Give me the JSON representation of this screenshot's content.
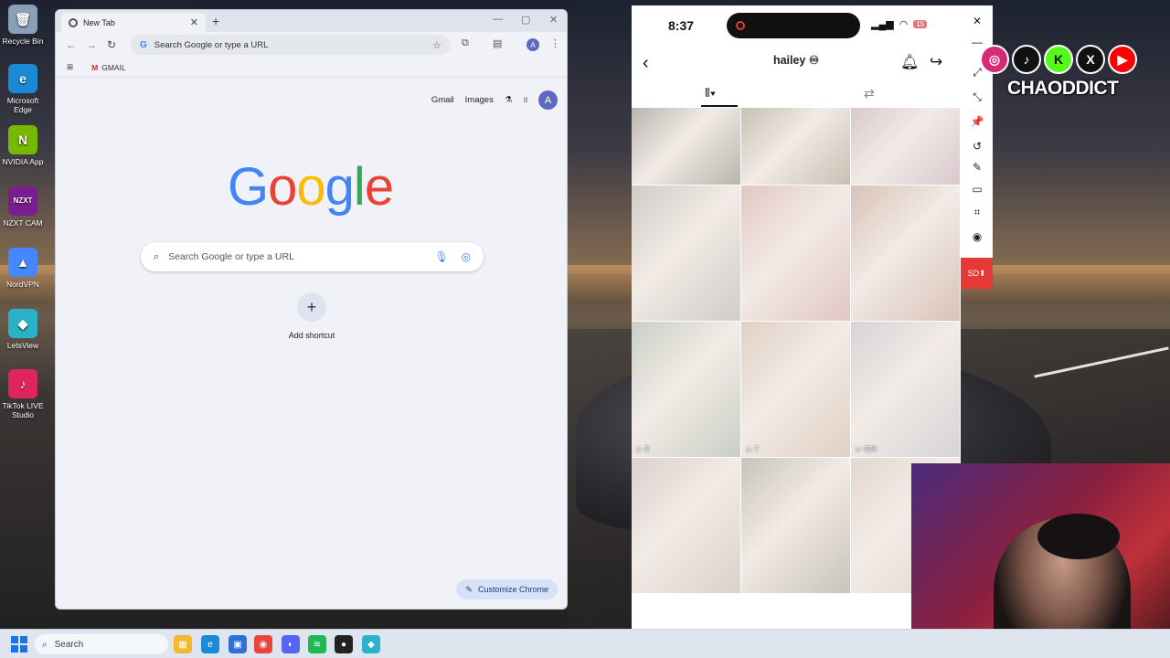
{
  "desktop": {
    "icons": [
      {
        "label": "Recycle Bin",
        "glyph": "🗑",
        "color": "#8aa0b8"
      },
      {
        "label": "Microsoft Edge",
        "glyph": "e",
        "color": "#1b8ad6"
      },
      {
        "label": "NVIDIA App",
        "glyph": "N",
        "color": "#76b900"
      },
      {
        "label": "NZXT CAM",
        "glyph": "NZXT",
        "color": "#7a1f8f"
      },
      {
        "label": "NordVPN",
        "glyph": "▲",
        "color": "#4687ff"
      },
      {
        "label": "LetsView",
        "glyph": "◆",
        "color": "#2ab3c8"
      },
      {
        "label": "TikTok LIVE Studio",
        "glyph": "♪",
        "color": "#e0245e"
      }
    ]
  },
  "chrome": {
    "tab_title": "New Tab",
    "tab_close": "✕",
    "new_tab": "+",
    "win_min": "—",
    "win_max": "▢",
    "win_close": "✕",
    "nav_back": "←",
    "nav_forward": "→",
    "nav_reload": "↻",
    "omnibox_placeholder": "Search Google or type a URL",
    "omnibox_g": "G",
    "omnibox_star": "☆",
    "bookmark_gmail": "GMAIL",
    "bookmark_gmail_icon": "M",
    "apps_grid": "⊞",
    "avatar_letter": "A",
    "ntp_gmail": "Gmail",
    "ntp_images": "Images",
    "ntp_flask": "⚗",
    "ntp_apps": "⋮⋮⋮",
    "logo": [
      "G",
      "o",
      "o",
      "g",
      "l",
      "e"
    ],
    "logo_colors": [
      "#4285f4",
      "#ea4335",
      "#fbbc05",
      "#4285f4",
      "#34a853",
      "#ea4335"
    ],
    "search_placeholder": "Search Google or type a URL",
    "search_icon": "🔍",
    "mic_icon": "🎤",
    "lens_icon": "◎",
    "shortcut_plus": "+",
    "shortcut_label": "Add shortcut",
    "customize_label": "Customize Chrome",
    "customize_icon": "✎"
  },
  "phone": {
    "time": "8:37",
    "signal": "▂▄▆",
    "wifi": "◠",
    "battery": "15",
    "back": "‹",
    "profile_name": "hailey ♾",
    "bell": "🔔",
    "share": "↪",
    "grid_tab": "⦀▾",
    "repost_tab": "⇄",
    "thumbnails": [
      {
        "views": "",
        "color": "#b8b4ac",
        "short": true
      },
      {
        "views": "",
        "color": "#c7c0b3",
        "short": true
      },
      {
        "views": "",
        "color": "#d9c8cd",
        "short": true
      },
      {
        "views": "",
        "color": "#d0ccc8"
      },
      {
        "views": "",
        "color": "#e2c6c2"
      },
      {
        "views": "",
        "color": "#d8c2b8"
      },
      {
        "views": "9",
        "color": "#c9cfc6"
      },
      {
        "views": "7",
        "color": "#e0d0c4"
      },
      {
        "views": "928",
        "color": "#d6d4d6"
      },
      {
        "views": "",
        "color": "#dcd0cc"
      },
      {
        "views": "",
        "color": "#c8c4ba"
      },
      {
        "views": "",
        "color": "#e4d8cf"
      }
    ]
  },
  "side_toolbar": {
    "tools": [
      "✕",
      "—",
      "⤢",
      "⤡",
      "📌",
      "↺",
      "✎",
      "▭",
      "⌗",
      "◉"
    ],
    "sd_label": "SD⬆"
  },
  "overlay": {
    "socials": [
      {
        "glyph": "◎",
        "color": "#d62976"
      },
      {
        "glyph": "♪",
        "color": "#111111"
      },
      {
        "glyph": "K",
        "color": "#53fc18"
      },
      {
        "glyph": "X",
        "color": "#111111"
      },
      {
        "glyph": "▶",
        "color": "#ff0000"
      }
    ],
    "brand": "CHAODDICT"
  },
  "taskbar": {
    "search_label": "Search",
    "search_icon": "🔍",
    "apps": [
      {
        "glyph": "▦",
        "color": "#f3b92c"
      },
      {
        "glyph": "e",
        "color": "#1b8ad6"
      },
      {
        "glyph": "▣",
        "color": "#2f6fd6"
      },
      {
        "glyph": "◉",
        "color": "#e8453c"
      },
      {
        "glyph": "◐",
        "color": "#5865f2"
      },
      {
        "glyph": "≋",
        "color": "#1db954"
      },
      {
        "glyph": "●",
        "color": "#222222"
      },
      {
        "glyph": "◆",
        "color": "#2ab3c8"
      }
    ]
  }
}
